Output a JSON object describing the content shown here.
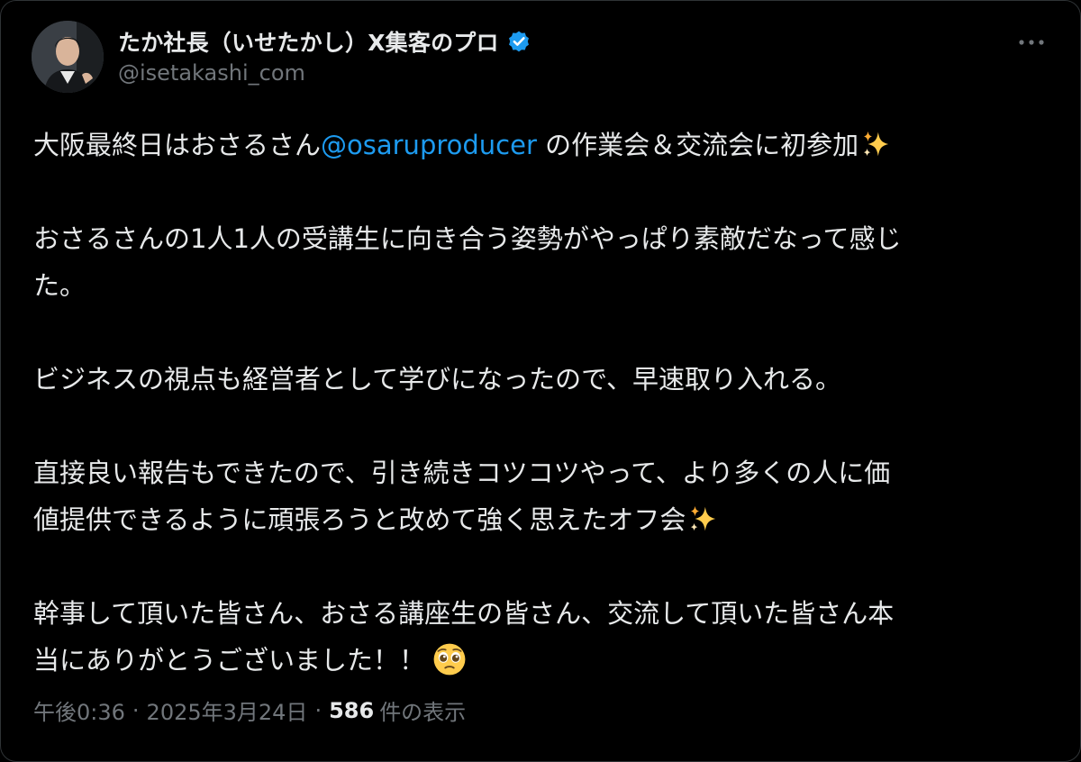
{
  "author": {
    "display_name": "たか社長（いせたかし）X集客のプロ",
    "handle": "@isetakashi_com",
    "verified": true,
    "verified_color": "#1d9bf0"
  },
  "post": {
    "line1_pre": "大阪最終日はおさるさん",
    "line1_mention": "@osaruproducer",
    "line1_post": " の作業会＆交流会に初参加",
    "para2_line1": "おさるさんの1人1人の受講生に向き合う姿勢がやっぱり素敵だなって感じ",
    "para2_line2": "た。",
    "para3": "ビジネスの視点も経営者として学びになったので、早速取り入れる。",
    "para4_line1": "直接良い報告もできたので、引き続きコツコツやって、より多くの人に価",
    "para4_line2": "値提供できるように頑張ろうと改めて強く思えたオフ会",
    "para5_line1": "幹事して頂いた皆さん、おさる講座生の皆さん、交流して頂いた皆さん本",
    "para5_line2": "当にありがとうございました！！",
    "emoji_1": "sparkles-icon",
    "emoji_2": "pleading-face-icon"
  },
  "meta": {
    "time": "午後0:36",
    "separator": "·",
    "date": "2025年3月24日",
    "views_count": "586",
    "views_label": "件の表示"
  },
  "colors": {
    "background": "#000000",
    "text": "#e7e9ea",
    "secondary": "#71767b",
    "accent": "#1d9bf0"
  }
}
